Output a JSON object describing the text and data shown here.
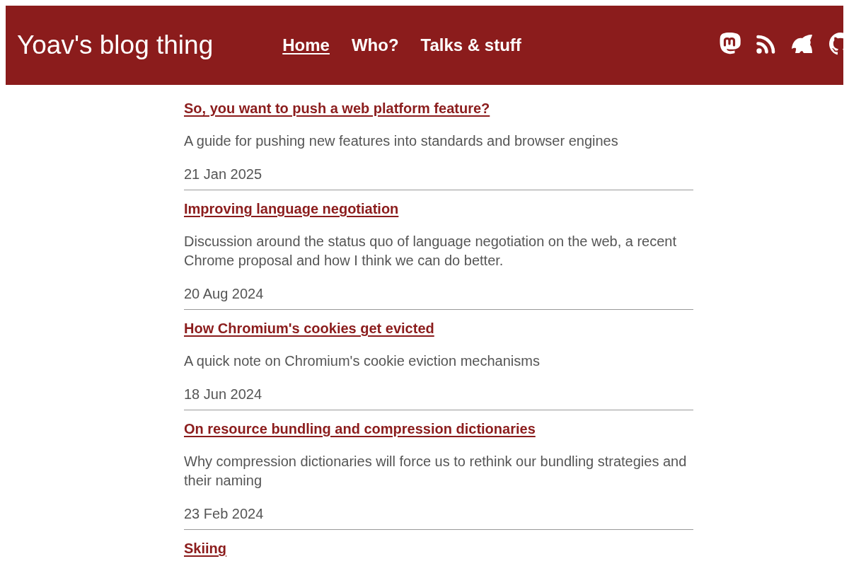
{
  "header": {
    "title": "Yoav's blog thing",
    "nav": [
      {
        "label": "Home",
        "selected": true
      },
      {
        "label": "Who?",
        "selected": false
      },
      {
        "label": "Talks & stuff",
        "selected": false
      }
    ]
  },
  "posts": [
    {
      "title": "So, you want to push a web platform feature?",
      "summary": "A guide for pushing new features into standards and browser engines",
      "date": "21 Jan 2025"
    },
    {
      "title": "Improving language negotiation",
      "summary": "Discussion around the status quo of language negotiation on the web, a recent Chrome proposal and how I think we can do better.",
      "date": "20 Aug 2024"
    },
    {
      "title": "How Chromium's cookies get evicted",
      "summary": "A quick note on Chromium's cookie eviction mechanisms",
      "date": "18 Jun 2024"
    },
    {
      "title": "On resource bundling and compression dictionaries",
      "summary": "Why compression dictionaries will force us to rethink our bundling strategies and their naming",
      "date": "23 Feb 2024"
    },
    {
      "title": "Skiing"
    }
  ]
}
